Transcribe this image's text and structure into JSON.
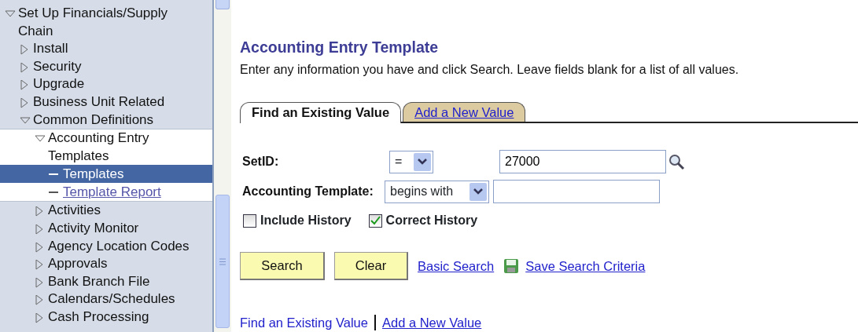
{
  "sidebar": {
    "tree": [
      {
        "kind": "folder",
        "label": "Set Up Financials/Supply Chain",
        "expanded": true,
        "children": [
          {
            "kind": "folder",
            "label": "Install",
            "expanded": false
          },
          {
            "kind": "folder",
            "label": "Security",
            "expanded": false
          },
          {
            "kind": "folder",
            "label": "Upgrade",
            "expanded": false
          },
          {
            "kind": "folder",
            "label": "Business Unit Related",
            "expanded": false
          },
          {
            "kind": "folder",
            "label": "Common Definitions",
            "expanded": true,
            "children": [
              {
                "kind": "folder",
                "label": "Accounting Entry Templates",
                "expanded": true,
                "current": true,
                "children": [
                  {
                    "kind": "page",
                    "label": "Templates",
                    "selected": true
                  },
                  {
                    "kind": "page",
                    "label": "Template Report",
                    "selected": false
                  }
                ]
              },
              {
                "kind": "folder",
                "label": "Activities",
                "expanded": false
              },
              {
                "kind": "folder",
                "label": "Activity Monitor",
                "expanded": false
              },
              {
                "kind": "folder",
                "label": "Agency Location Codes",
                "expanded": false
              },
              {
                "kind": "folder",
                "label": "Approvals",
                "expanded": false
              },
              {
                "kind": "folder",
                "label": "Bank Branch File",
                "expanded": false
              },
              {
                "kind": "folder",
                "label": "Calendars/Schedules",
                "expanded": false
              },
              {
                "kind": "folder",
                "label": "Cash Processing",
                "expanded": false
              }
            ]
          }
        ]
      }
    ]
  },
  "page": {
    "title": "Accounting Entry Template",
    "instructions": "Enter any information you have and click Search. Leave fields blank for a list of all values.",
    "tabs": [
      {
        "label": "Find an Existing Value",
        "selected": true
      },
      {
        "label": "Add a New Value",
        "selected": false
      }
    ],
    "fields": [
      {
        "label": "SetID:",
        "operator": "=",
        "value": "27000",
        "lookup": true
      },
      {
        "label": "Accounting Template:",
        "operator": "begins with",
        "lookup": false
      }
    ],
    "checkboxes": [
      {
        "label": "Include History",
        "checked": false
      },
      {
        "label": "Correct History",
        "checked": true
      }
    ],
    "buttons": [
      "Search",
      "Clear"
    ],
    "links": [
      {
        "label": "Basic Search",
        "kind": "link"
      },
      {
        "label": "Save Search Criteria",
        "kind": "save"
      }
    ],
    "footer_links": [
      {
        "label": "Find an Existing Value",
        "selected": true
      },
      {
        "label": "Add a New Value",
        "selected": false
      }
    ]
  }
}
